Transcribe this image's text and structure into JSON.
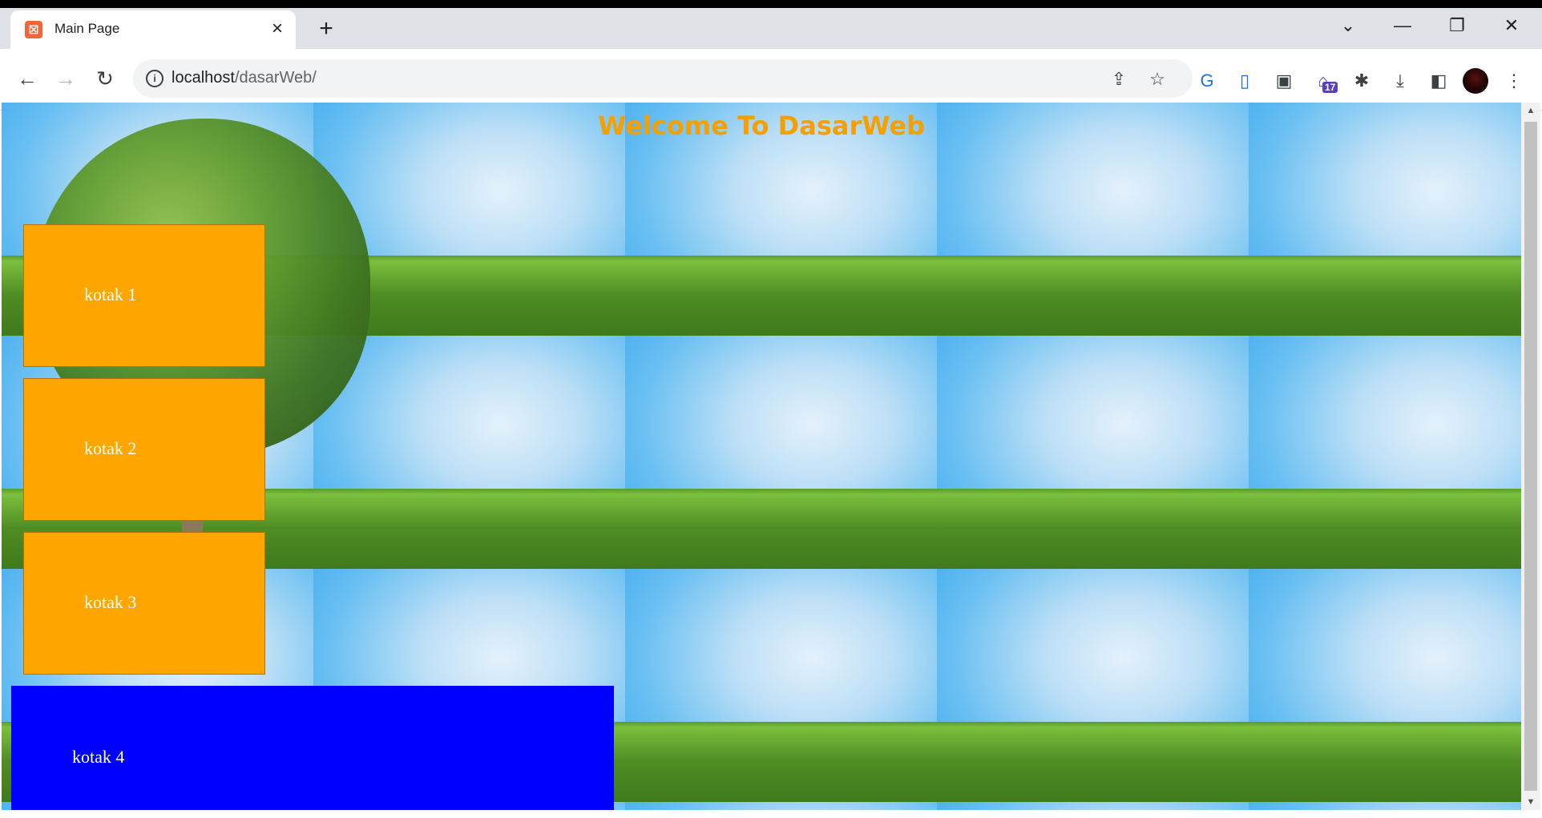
{
  "browser": {
    "tab": {
      "title": "Main Page",
      "favicon": "xampp-icon",
      "close": "×"
    },
    "new_tab": "+",
    "window_controls": {
      "tab_search": "⌄",
      "minimize": "—",
      "restore": "❐",
      "close": "✕"
    },
    "nav": {
      "back": "←",
      "forward": "→",
      "reload": "↻"
    },
    "address": {
      "host": "localhost",
      "path": "/dasarWeb/"
    },
    "extensions": {
      "badge_count": "17"
    }
  },
  "page": {
    "heading": "Welcome To DasarWeb",
    "boxes": [
      {
        "label": "kotak 1",
        "color": "#ffa500"
      },
      {
        "label": "kotak 2",
        "color": "#ffa500"
      },
      {
        "label": "kotak 3",
        "color": "#ffa500"
      },
      {
        "label": "kotak 4",
        "color": "#0000ff"
      }
    ]
  },
  "colors": {
    "heading": "#f5a000",
    "box_orange": "#ffa500",
    "box_blue": "#0000ff"
  }
}
